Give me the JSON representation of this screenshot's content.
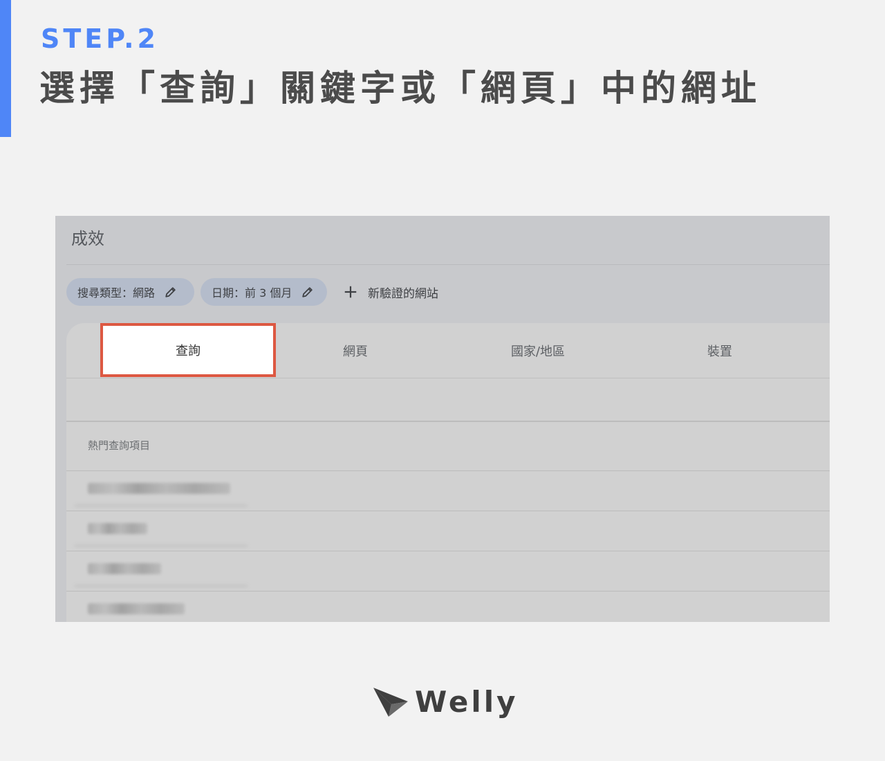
{
  "header": {
    "step_label": "STEP.2",
    "headline": "選擇「查詢」關鍵字或「網頁」中的網址",
    "accent_color": "#4f86f7"
  },
  "panel": {
    "title": "成效",
    "chips": [
      {
        "label": "搜尋類型：網路",
        "icon": "pencil-icon"
      },
      {
        "label": "日期：前 3 個月",
        "icon": "pencil-icon"
      }
    ],
    "add_label": "新驗證的網站",
    "tabs": [
      {
        "label": "查詢",
        "selected": true
      },
      {
        "label": "網頁",
        "selected": false
      },
      {
        "label": "國家/地區",
        "selected": false
      },
      {
        "label": "裝置",
        "selected": false
      }
    ],
    "highlight_color": "#dd5842",
    "table_header": "熱門查詢項目"
  },
  "brand": {
    "name": "Welly",
    "icon": "paper-plane-icon"
  }
}
